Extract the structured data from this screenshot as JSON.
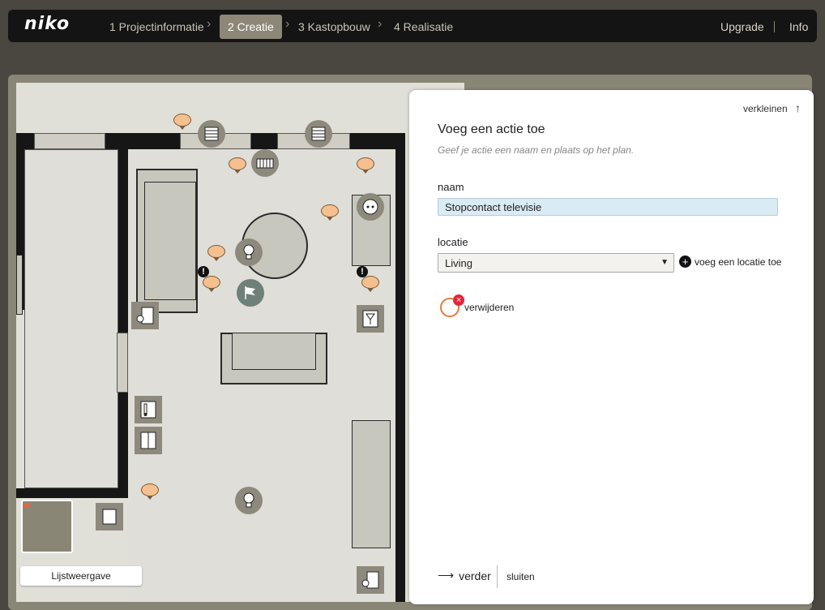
{
  "topbar": {
    "logo": "niko",
    "steps": [
      "1 Projectinformatie",
      "2 Creatie",
      "3 Kastopbouw",
      "4 Realisatie"
    ],
    "active_step": "2 Creatie",
    "upgrade": "Upgrade",
    "info": "Info"
  },
  "plan": {
    "list_view_button": "Lijstweergave"
  },
  "panel": {
    "collapse_label": "verkleinen",
    "title": "Voeg een actie toe",
    "subtitle": "Geef je actie een naam en plaats op het plan.",
    "name_label": "naam",
    "name_value": "Stopcontact televisie",
    "location_label": "locatie",
    "location_value": "Living",
    "add_location": "voeg een locatie toe",
    "remove_label": "verwijderen",
    "next_label": "verder",
    "close_label": "sluiten"
  },
  "colors": {
    "accent": "#8c8776",
    "bubble": "#f5c08f",
    "remove_red": "#e3263b"
  }
}
